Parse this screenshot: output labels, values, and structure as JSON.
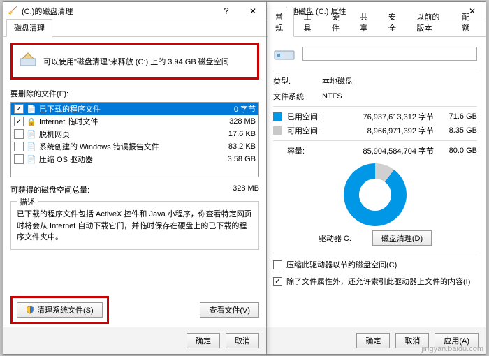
{
  "left": {
    "title": "(C:)的磁盘清理",
    "tab_label": "磁盘清理",
    "message": "可以使用\"磁盘清理\"来释放  (C:) 上的 3.94 GB 磁盘空间",
    "files_to_delete_label": "要删除的文件(F):",
    "files": [
      {
        "checked": true,
        "icon": "📄",
        "name": "已下载的程序文件",
        "size": "0 字节",
        "selected": true
      },
      {
        "checked": true,
        "icon": "🔒",
        "name": "Internet 临时文件",
        "size": "328 MB",
        "selected": false
      },
      {
        "checked": false,
        "icon": "📄",
        "name": "脱机网页",
        "size": "17.6 KB",
        "selected": false
      },
      {
        "checked": false,
        "icon": "📄",
        "name": "系统创建的 Windows 错误报告文件",
        "size": "83.2 KB",
        "selected": false
      },
      {
        "checked": false,
        "icon": "📄",
        "name": "压缩 OS 驱动器",
        "size": "3.58 GB",
        "selected": false
      }
    ],
    "total_label": "可获得的磁盘空间总量:",
    "total_value": "328 MB",
    "desc_legend": "描述",
    "desc_text": "已下载的程序文件包括 ActiveX 控件和 Java 小程序，你查看特定网页时将会从 Internet 自动下载它们，并临时保存在硬盘上的已下载的程序文件夹中。",
    "clean_system_btn": "清理系统文件(S)",
    "view_files_btn": "查看文件(V)",
    "ok_btn": "确定",
    "cancel_btn": "取消"
  },
  "right": {
    "title": "本地磁盘 (C:) 属性",
    "tabs": [
      "常规",
      "工具",
      "硬件",
      "共享",
      "安全",
      "以前的版本",
      "配额"
    ],
    "active_tab": 0,
    "name_input": "",
    "type_label": "类型:",
    "type_value": "本地磁盘",
    "fs_label": "文件系统:",
    "fs_value": "NTFS",
    "used_label": "已用空间:",
    "used_bytes": "76,937,613,312 字节",
    "used_gb": "71.6 GB",
    "free_label": "可用空间:",
    "free_bytes": "8,966,971,392 字节",
    "free_gb": "8.35 GB",
    "capacity_label": "容量:",
    "capacity_bytes": "85,904,584,704 字节",
    "capacity_gb": "80.0 GB",
    "drive_caption": "驱动器 C:",
    "disk_cleanup_btn": "磁盘清理(D)",
    "compress_label": "压缩此驱动器以节约磁盘空间(C)",
    "index_label": "除了文件属性外，还允许索引此驱动器上文件的内容(I)",
    "ok_btn": "确定",
    "cancel_btn": "取消",
    "apply_btn": "应用(A)"
  },
  "watermark": "jingyan.baidu.com"
}
